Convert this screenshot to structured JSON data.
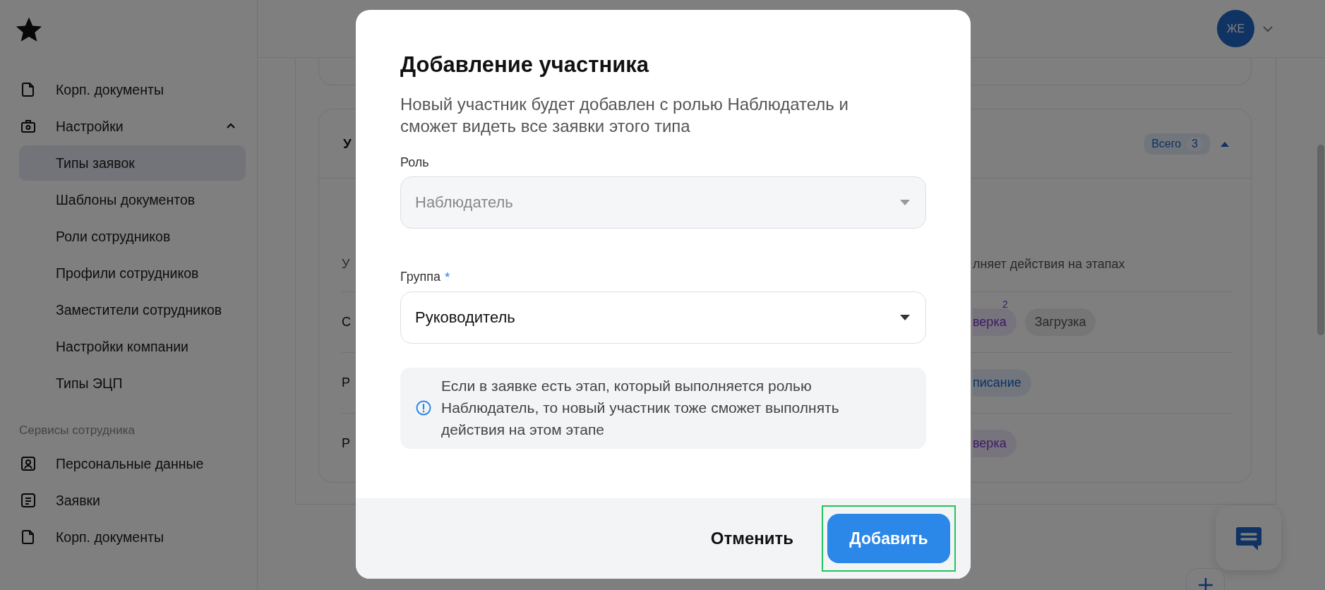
{
  "sidebar": {
    "items": [
      {
        "label": "Корп. документы",
        "kind": "document",
        "selected": false
      },
      {
        "label": "Настройки",
        "kind": "briefcase",
        "selected": false,
        "expanded": true,
        "children": [
          {
            "label": "Типы заявок",
            "selected": true
          },
          {
            "label": "Шаблоны документов",
            "selected": false
          },
          {
            "label": "Роли сотрудников",
            "selected": false
          },
          {
            "label": "Профили сотрудников",
            "selected": false
          },
          {
            "label": "Заместители сотрудников",
            "selected": false
          },
          {
            "label": "Настройки компании",
            "selected": false
          },
          {
            "label": "Типы ЭЦП",
            "selected": false
          }
        ]
      }
    ],
    "sections": [
      {
        "title": "Сервисы сотрудника",
        "items": [
          {
            "label": "Персональные данные",
            "kind": "person",
            "selected": false
          },
          {
            "label": "Заявки",
            "kind": "list",
            "selected": false
          },
          {
            "label": "Корп. документы",
            "kind": "document",
            "selected": false
          }
        ]
      }
    ]
  },
  "header": {
    "avatar": "ЖЕ"
  },
  "members_card": {
    "title": "У",
    "total_label": "Всего",
    "total": "3",
    "expanded": true,
    "header_cells": [
      "У",
      "лняет действия на этапах"
    ],
    "rows": [
      {
        "cell": "С",
        "stages": [
          {
            "label": "верка",
            "kind": "review",
            "count": "2"
          },
          {
            "label": "Загрузка",
            "kind": "upload"
          }
        ]
      },
      {
        "cell": "Р",
        "stages": [
          {
            "label": "писание",
            "kind": "sign"
          }
        ]
      },
      {
        "cell": "Р",
        "stages": [
          {
            "label": "верка",
            "kind": "review"
          }
        ]
      }
    ]
  },
  "dialog": {
    "title": "Добавление участника",
    "description": "Новый участник будет добавлен с ролью Наблюдатель и сможет видеть все заявки этого типа",
    "fields": [
      {
        "label": "Роль",
        "value": "Наблюдатель",
        "disabled": true
      },
      {
        "label": "Группа",
        "value": "Руководитель",
        "disabled": false,
        "required_mark": "*"
      }
    ],
    "note": "Если в заявке есть этап, который выполняется ролью Наблюдатель, то новый участник тоже сможет выполнять действия на этом этапе",
    "buttons": [
      {
        "label": "Отменить",
        "kind": "secondary"
      },
      {
        "label": "Добавить",
        "kind": "primary",
        "highlighted": true
      }
    ]
  }
}
